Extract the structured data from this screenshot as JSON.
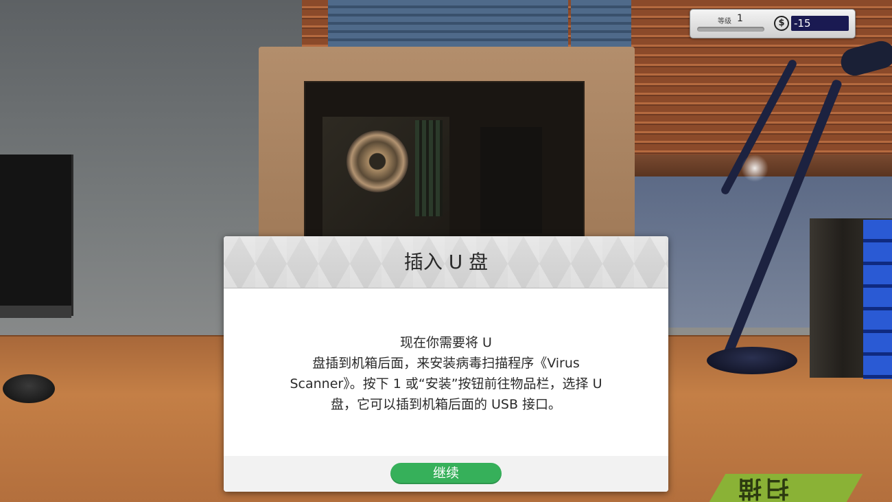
{
  "hud": {
    "level_label": "等级",
    "level_value": "1",
    "level_progress": 0,
    "money_icon": "dollar-icon",
    "money_value": "-15"
  },
  "dialog": {
    "title": "插入 U 盘",
    "body_lines": [
      "现在你需要将 U",
      "盘插到机箱后面，来安装病毒扫描程序《Virus",
      "Scanner》。按下 1 或“安装”按钮前往物品栏，选择 U",
      "盘，它可以插到机箱后面的 USB 接口。"
    ],
    "continue_label": "继续"
  },
  "scene": {
    "scan_pad_label": "扫描"
  }
}
